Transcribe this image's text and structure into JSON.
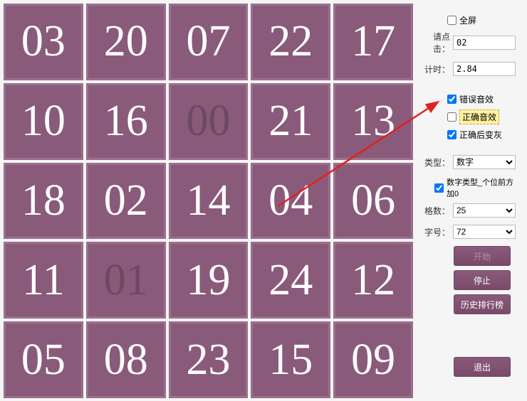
{
  "grid": {
    "cells": [
      {
        "v": "03",
        "c": false
      },
      {
        "v": "20",
        "c": false
      },
      {
        "v": "07",
        "c": false
      },
      {
        "v": "22",
        "c": false
      },
      {
        "v": "17",
        "c": false
      },
      {
        "v": "10",
        "c": false
      },
      {
        "v": "16",
        "c": false
      },
      {
        "v": "00",
        "c": true
      },
      {
        "v": "21",
        "c": false
      },
      {
        "v": "13",
        "c": false
      },
      {
        "v": "18",
        "c": false
      },
      {
        "v": "02",
        "c": false
      },
      {
        "v": "14",
        "c": false
      },
      {
        "v": "04",
        "c": false
      },
      {
        "v": "06",
        "c": false
      },
      {
        "v": "11",
        "c": false
      },
      {
        "v": "01",
        "c": true
      },
      {
        "v": "19",
        "c": false
      },
      {
        "v": "24",
        "c": false
      },
      {
        "v": "12",
        "c": false
      },
      {
        "v": "05",
        "c": false
      },
      {
        "v": "08",
        "c": false
      },
      {
        "v": "23",
        "c": false
      },
      {
        "v": "15",
        "c": false
      },
      {
        "v": "09",
        "c": false
      }
    ]
  },
  "sidebar": {
    "fullscreen": {
      "label": "全屏",
      "checked": false
    },
    "click_prompt": {
      "label": "请点击：",
      "value": "02"
    },
    "timer": {
      "label": "计时：",
      "value": "2.84"
    },
    "error_sound": {
      "label": "错误音效",
      "checked": true
    },
    "correct_sound": {
      "label": "正确音效",
      "checked": false
    },
    "gray_after": {
      "label": "正确后变灰",
      "checked": true
    },
    "type": {
      "label": "类型：",
      "value": "数字"
    },
    "leading_zero": {
      "label": "数字类型_个位前方加0",
      "checked": true
    },
    "count": {
      "label": "格数：",
      "value": "25"
    },
    "font": {
      "label": "字号：",
      "value": "72"
    },
    "start_btn": "开始",
    "stop_btn": "停止",
    "history_btn": "历史排行榜",
    "exit_btn": "退出"
  }
}
